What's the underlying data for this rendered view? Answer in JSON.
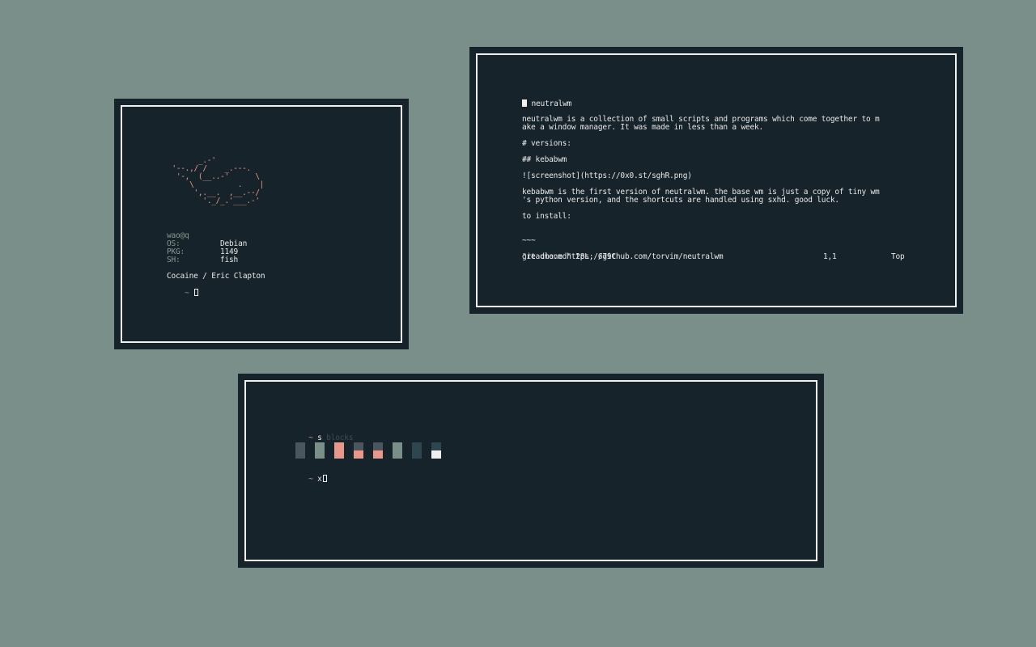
{
  "colors": {
    "desktop": "#7a8f8a",
    "window_bg": "#17232a",
    "border": "#f0f0f0",
    "accent": "#e8988a",
    "dim": "#8a9691"
  },
  "fetch_window": {
    "ascii_art": "       _.-'\n '--.,/ /    _.---.\n  '-,  (__..-'      \\\n     \\          .    |\n      ',.__.  ,__.--/\n        '._/_.'___.-'",
    "user_host": "wao@q",
    "rows": [
      {
        "key": "OS:",
        "value": "Debian"
      },
      {
        "key": "PKG:",
        "value": "1149"
      },
      {
        "key": "SH:",
        "value": "fish"
      }
    ],
    "now_playing": "Cocaine / Eric Clapton",
    "prompt": "~"
  },
  "editor_window": {
    "lines": [
      "# neutralwm",
      "",
      "neutralwm is a collection of small scripts and programs which come together to m",
      "ake a window manager. It was made in less than a week.",
      "",
      "# versions:",
      "",
      "## kebabwm",
      "",
      "![screenshot](https://0x0.st/sghR.png)",
      "",
      "kebabwm is the first version of neutralwm. the base wm is just a copy of tiny wm",
      "'s python version, and the shortcuts are handled using sxhd. good luck.",
      "",
      "to install:",
      "",
      "",
      "~~~",
      "",
      "git clone https://github.com/torvim/neutralwm"
    ],
    "status_file": "\"readme.md\" 28L, 679C",
    "status_pos": "1,1",
    "status_scroll": "Top"
  },
  "blocks_window": {
    "prompt_symbol": "~",
    "command": "s",
    "suggestion": "blocks",
    "second_prompt_symbol": "~",
    "second_input": "x",
    "swatches": [
      {
        "top": "#4a5560",
        "bottom": "#4a5560"
      },
      {
        "top": "#7a8f8a",
        "bottom": "#7a8f8a"
      },
      {
        "top": "#e8988a",
        "bottom": "#e8988a"
      },
      {
        "top": "#4a5560",
        "bottom": "#e8988a"
      },
      {
        "top": "#4a5560",
        "bottom": "#e8988a"
      },
      {
        "top": "#7a8f8a",
        "bottom": "#7a8f8a"
      },
      {
        "top": "#2e4650",
        "bottom": "#2e4650"
      },
      {
        "top": "#2e4650",
        "bottom": "#f0f0f0"
      }
    ]
  }
}
